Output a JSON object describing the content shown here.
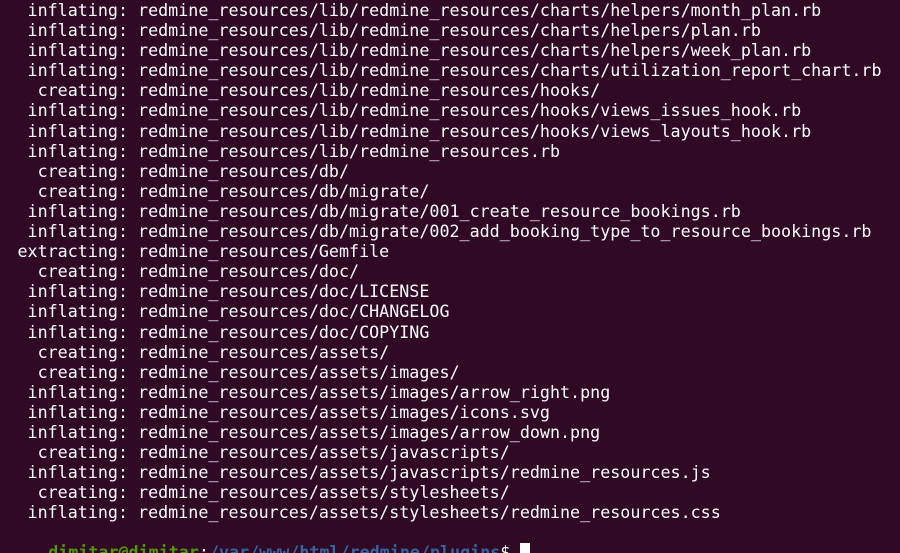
{
  "terminal": {
    "lines": [
      {
        "action": "inflating:",
        "path": "redmine_resources/lib/redmine_resources/charts/helpers/month_plan.rb"
      },
      {
        "action": "inflating:",
        "path": "redmine_resources/lib/redmine_resources/charts/helpers/plan.rb"
      },
      {
        "action": "inflating:",
        "path": "redmine_resources/lib/redmine_resources/charts/helpers/week_plan.rb"
      },
      {
        "action": "inflating:",
        "path": "redmine_resources/lib/redmine_resources/charts/utilization_report_chart.rb"
      },
      {
        "action": "creating:",
        "path": "redmine_resources/lib/redmine_resources/hooks/"
      },
      {
        "action": "inflating:",
        "path": "redmine_resources/lib/redmine_resources/hooks/views_issues_hook.rb"
      },
      {
        "action": "inflating:",
        "path": "redmine_resources/lib/redmine_resources/hooks/views_layouts_hook.rb"
      },
      {
        "action": "inflating:",
        "path": "redmine_resources/lib/redmine_resources.rb"
      },
      {
        "action": "creating:",
        "path": "redmine_resources/db/"
      },
      {
        "action": "creating:",
        "path": "redmine_resources/db/migrate/"
      },
      {
        "action": "inflating:",
        "path": "redmine_resources/db/migrate/001_create_resource_bookings.rb"
      },
      {
        "action": "inflating:",
        "path": "redmine_resources/db/migrate/002_add_booking_type_to_resource_bookings.rb"
      },
      {
        "action": "extracting:",
        "path": "redmine_resources/Gemfile"
      },
      {
        "action": "creating:",
        "path": "redmine_resources/doc/"
      },
      {
        "action": "inflating:",
        "path": "redmine_resources/doc/LICENSE"
      },
      {
        "action": "inflating:",
        "path": "redmine_resources/doc/CHANGELOG"
      },
      {
        "action": "inflating:",
        "path": "redmine_resources/doc/COPYING"
      },
      {
        "action": "creating:",
        "path": "redmine_resources/assets/"
      },
      {
        "action": "creating:",
        "path": "redmine_resources/assets/images/"
      },
      {
        "action": "inflating:",
        "path": "redmine_resources/assets/images/arrow_right.png"
      },
      {
        "action": "inflating:",
        "path": "redmine_resources/assets/images/icons.svg"
      },
      {
        "action": "inflating:",
        "path": "redmine_resources/assets/images/arrow_down.png"
      },
      {
        "action": "creating:",
        "path": "redmine_resources/assets/javascripts/"
      },
      {
        "action": "inflating:",
        "path": "redmine_resources/assets/javascripts/redmine_resources.js"
      },
      {
        "action": "creating:",
        "path": "redmine_resources/assets/stylesheets/"
      },
      {
        "action": "inflating:",
        "path": "redmine_resources/assets/stylesheets/redmine_resources.css"
      }
    ],
    "prompt": {
      "user_host": "dimitar@dimitar",
      "separator": ":",
      "cwd": "/var/www/html/redmine/plugins",
      "symbol": "$"
    }
  },
  "colors": {
    "background": "#300a24",
    "text": "#ffffff",
    "prompt_user": "#4e9a06",
    "prompt_cwd": "#3465a4"
  }
}
